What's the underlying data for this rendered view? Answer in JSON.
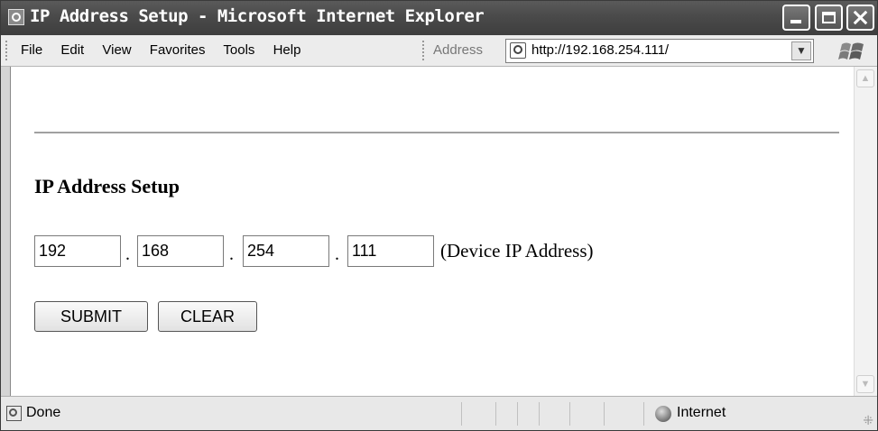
{
  "window": {
    "title": "IP Address Setup - Microsoft Internet Explorer",
    "icon": "ie-page-icon"
  },
  "menu": {
    "items": [
      "File",
      "Edit",
      "View",
      "Favorites",
      "Tools",
      "Help"
    ]
  },
  "address_bar": {
    "label": "Address",
    "url": "http://192.168.254.111/"
  },
  "page": {
    "heading": "IP Address Setup",
    "ip_fields": [
      "192",
      "168",
      "254",
      "111"
    ],
    "separator": ".",
    "description": "(Device IP Address)",
    "submit_label": "SUBMIT",
    "clear_label": "CLEAR"
  },
  "status": {
    "text": "Done",
    "zone": "Internet"
  }
}
